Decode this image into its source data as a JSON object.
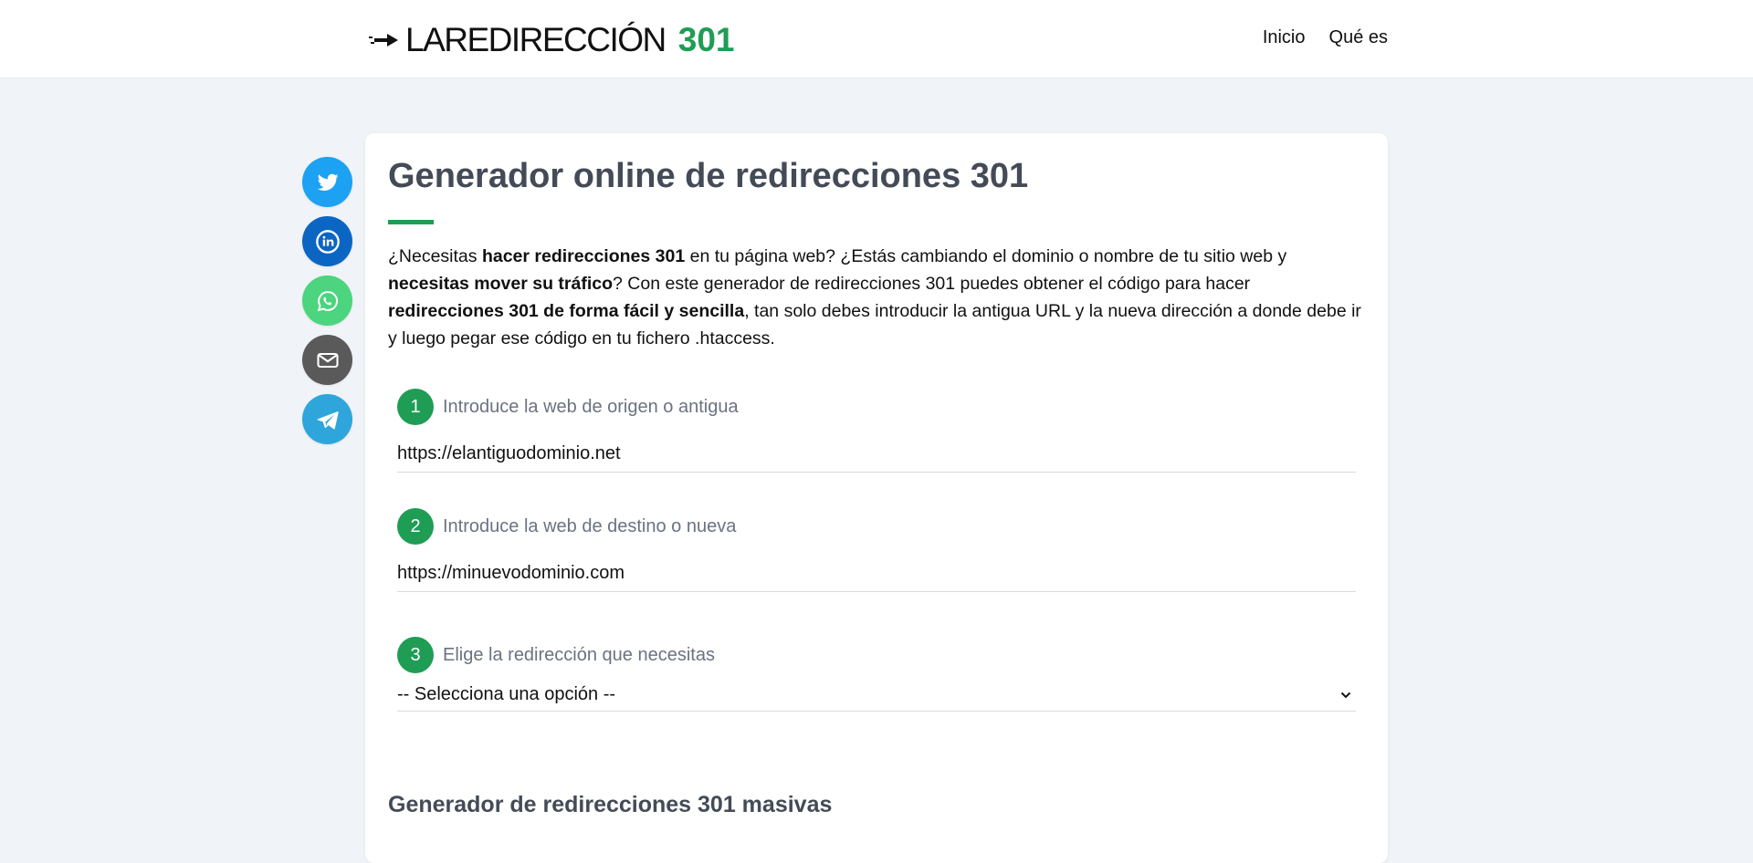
{
  "header": {
    "logo_text": "LAREDIRECCIÓN",
    "logo_number": "301",
    "nav": [
      {
        "label": "Inicio"
      },
      {
        "label": "Qué es"
      }
    ]
  },
  "share": [
    {
      "icon": "twitter-icon",
      "color": "#1da1f2"
    },
    {
      "icon": "linkedin-icon",
      "color": "#0a66c2"
    },
    {
      "icon": "whatsapp-icon",
      "color": "#4cd47e"
    },
    {
      "icon": "email-icon",
      "color": "#5a5a5a"
    },
    {
      "icon": "telegram-icon",
      "color": "#2ea6dc"
    }
  ],
  "main": {
    "title": "Generador online de redirecciones 301",
    "intro": {
      "p1": "¿Necesitas ",
      "b1": "hacer redirecciones 301",
      "p2": " en tu página web? ¿Estás cambiando el dominio o nombre de tu sitio web y ",
      "b2": "necesitas mover su tráfico",
      "p3": "? Con este generador de redirecciones 301 puedes obtener el código para hacer ",
      "b3": "redirecciones 301 de forma fácil y sencilla",
      "p4": ", tan solo debes introducir la antigua URL y la nueva dirección a donde debe ir y luego pegar ese código en tu fichero .htaccess."
    },
    "steps": [
      {
        "number": "1",
        "label": "Introduce la web de origen o antigua",
        "value": "https://elantiguodominio.net"
      },
      {
        "number": "2",
        "label": "Introduce la web de destino o nueva",
        "value": "https://minuevodominio.com"
      },
      {
        "number": "3",
        "label": "Elige la redirección que necesitas",
        "value": "-- Selecciona una opción --"
      }
    ],
    "section2_title": "Generador de redirecciones 301 masivas"
  },
  "colors": {
    "accent": "#1f9d55",
    "heading": "#444b57",
    "background": "#f0f3f7"
  }
}
